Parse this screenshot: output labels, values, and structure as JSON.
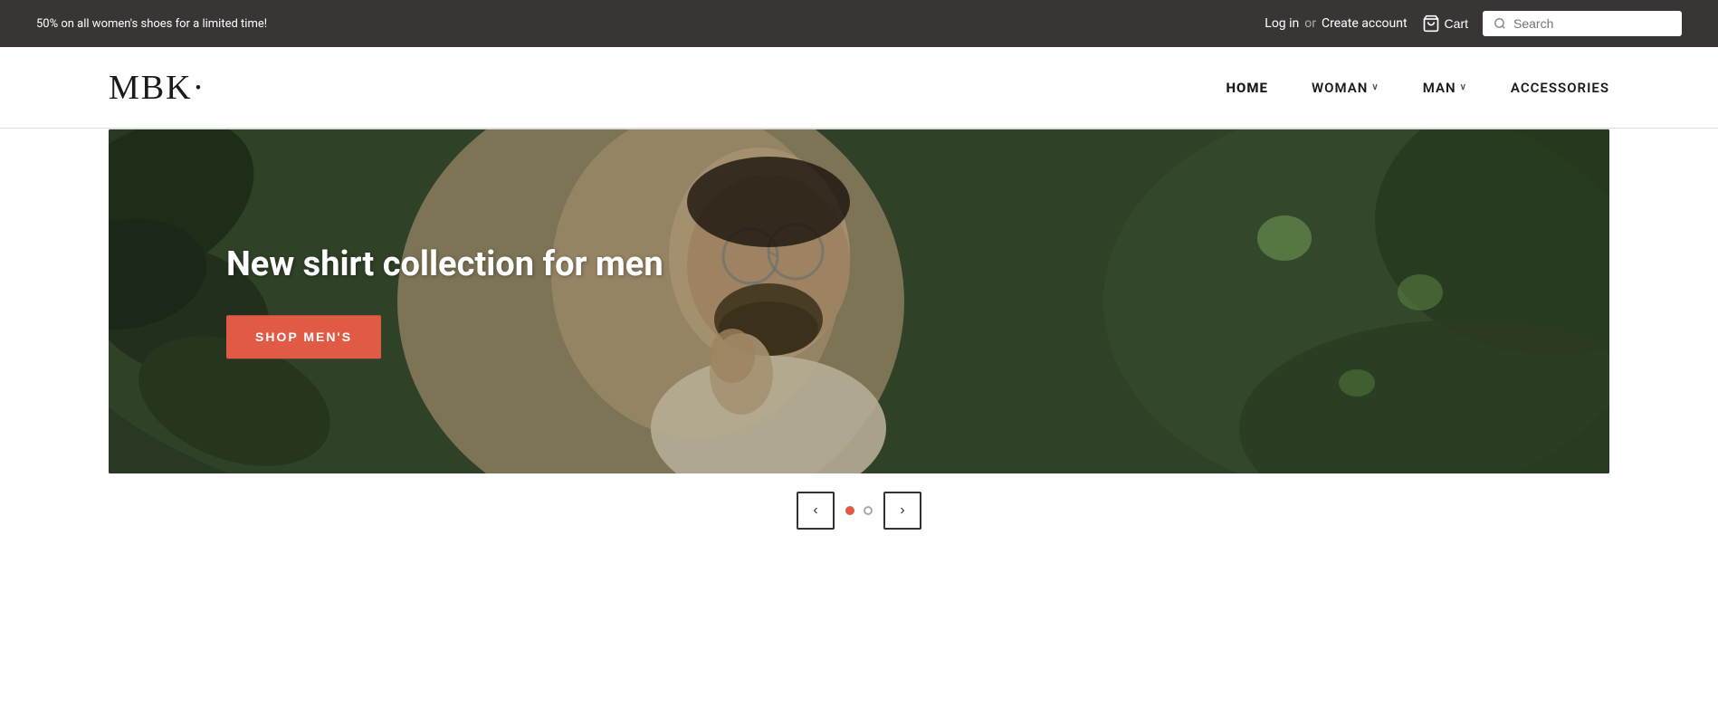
{
  "announcement": {
    "text": "50% on all women's shoes for a limited time!"
  },
  "topNav": {
    "login_label": "Log in",
    "separator": "or",
    "create_account_label": "Create account",
    "cart_label": "Cart",
    "search_placeholder": "Search"
  },
  "mainNav": {
    "logo": "MBK·",
    "links": [
      {
        "id": "home",
        "label": "HOME",
        "active": true,
        "hasDropdown": false
      },
      {
        "id": "woman",
        "label": "WOMAN",
        "active": false,
        "hasDropdown": true
      },
      {
        "id": "man",
        "label": "MAN",
        "active": false,
        "hasDropdown": true
      },
      {
        "id": "accessories",
        "label": "ACCESSORIES",
        "active": false,
        "hasDropdown": false
      }
    ]
  },
  "hero": {
    "title": "New shirt collection for men",
    "cta_label": "SHOP MEN'S"
  },
  "sliderControls": {
    "prev_label": "‹",
    "next_label": "›",
    "dots": [
      {
        "id": "dot1",
        "active": true
      },
      {
        "id": "dot2",
        "active": false
      }
    ]
  },
  "icons": {
    "search": "🔍",
    "cart": "🛒",
    "chevron_down": "∨"
  }
}
